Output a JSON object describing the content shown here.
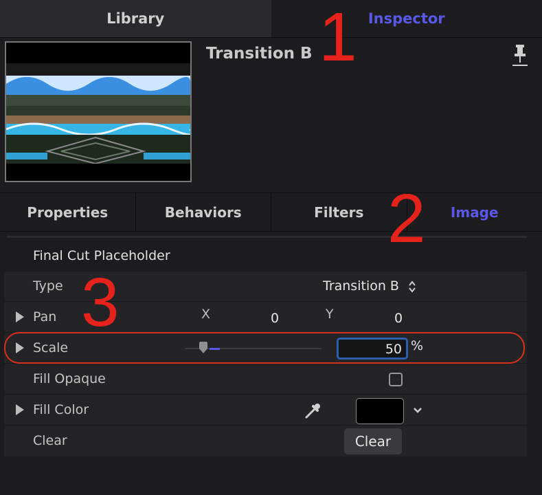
{
  "top_tabs": [
    {
      "label": "Library",
      "active": false
    },
    {
      "label": "Inspector",
      "active": true
    }
  ],
  "header": {
    "title": "Transition B",
    "thumbnail_name": "transition-thumbnail"
  },
  "inspector_tabs": [
    {
      "label": "Properties",
      "active": false
    },
    {
      "label": "Behaviors",
      "active": false
    },
    {
      "label": "Filters",
      "active": false
    },
    {
      "label": "Image",
      "active": true
    }
  ],
  "section": {
    "title": "Final Cut Placeholder"
  },
  "rows": {
    "type": {
      "label": "Type",
      "value": "Transition B"
    },
    "pan": {
      "label": "Pan",
      "x_label": "X",
      "x_value": "0",
      "y_label": "Y",
      "y_value": "0"
    },
    "scale": {
      "label": "Scale",
      "value": "50",
      "unit": "%",
      "slider_level": 0.16
    },
    "fill_opaque": {
      "label": "Fill Opaque",
      "checked": false
    },
    "fill_color": {
      "label": "Fill Color",
      "color": "#000000"
    },
    "clear": {
      "label": "Clear",
      "button_label": "Clear"
    }
  },
  "annotations": [
    "1",
    "2",
    "3"
  ],
  "colors": {
    "accent": "#5a58e8",
    "callout": "#e5221b",
    "focus": "#2c5fb0"
  }
}
